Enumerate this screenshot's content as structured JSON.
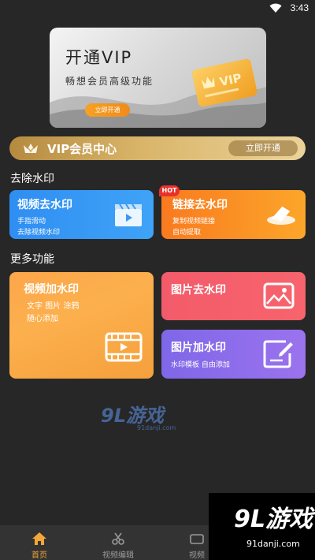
{
  "status_bar": {
    "time": "3:43"
  },
  "banner": {
    "title": "开通VIP",
    "subtitle": "畅想会员高级功能",
    "button": "立即开通",
    "card_text": "VIP"
  },
  "vip_bar": {
    "label": "VIP会员中心",
    "button": "立即开通"
  },
  "sections": {
    "remove_watermark": "去除水印",
    "more_features": "更多功能"
  },
  "tiles": {
    "video_remove": {
      "title": "视频去水印",
      "lines": [
        "手指滑动",
        "去除视频水印"
      ]
    },
    "link_remove": {
      "title": "链接去水印",
      "badge": "HOT",
      "lines": [
        "复制视频链接",
        "自动提取"
      ]
    },
    "video_add": {
      "title": "视频加水印",
      "lines": [
        "文字  图片  涂鸦",
        "随心添加"
      ]
    },
    "image_remove": {
      "title": "图片去水印"
    },
    "image_add": {
      "title": "图片加水印",
      "lines": [
        "水印模板  自由添加"
      ]
    }
  },
  "center_watermark": {
    "logo": "9L游戏",
    "url": "91danji.com"
  },
  "bottom_nav": [
    {
      "label": "首页",
      "icon": "home-icon",
      "active": true
    },
    {
      "label": "视频编辑",
      "icon": "scissors-icon",
      "active": false
    },
    {
      "label": "视频",
      "icon": "video-icon",
      "active": false
    },
    {
      "label": "",
      "icon": "user-icon",
      "active": false
    }
  ],
  "corner_watermark": {
    "logo": "9L游戏",
    "url": "91danji.com"
  },
  "colors": {
    "background": "#272727",
    "accent_orange": "#f3a63a",
    "blue": "#2f8ef2",
    "orange": "#f97a1f",
    "red": "#f35b6a",
    "purple": "#7f67e8",
    "gold": "#d9b56a"
  }
}
